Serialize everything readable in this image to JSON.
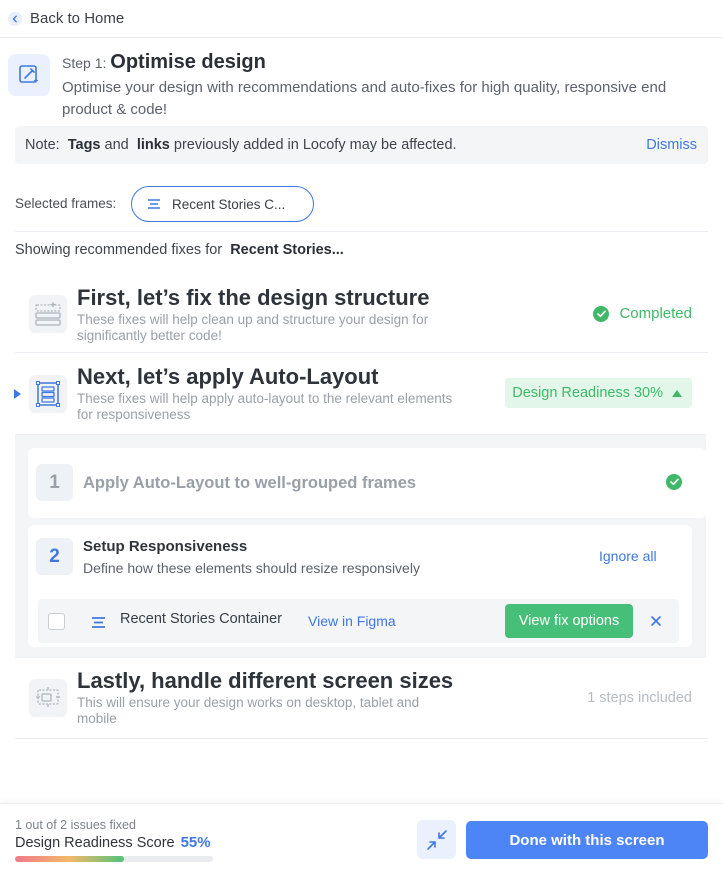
{
  "nav": {
    "back_label": "Back to Home"
  },
  "step": {
    "prefix": "Step 1: ",
    "title": "Optimise design",
    "description": "Optimise your design with recommendations and auto-fixes for high quality, responsive end product & code!"
  },
  "note": {
    "label": "Note:",
    "tags": "Tags",
    "and": "and",
    "links": "links",
    "rest": "previously added in Locofy may be affected.",
    "dismiss": "Dismiss"
  },
  "frames": {
    "label": "Selected frames:",
    "selected": "Recent Stories C..."
  },
  "showing": {
    "prefix": "Showing recommended fixes for",
    "target": "Recent Stories..."
  },
  "sections": [
    {
      "title": "First, let’s fix the design structure",
      "description": "These fixes will help clean up and structure your design for significantly better code!",
      "status": "Completed"
    },
    {
      "title": "Next, let’s apply Auto-Layout",
      "description": "These fixes will help apply auto-layout to the relevant elements for responsiveness",
      "readiness": "Design Readiness 30%"
    },
    {
      "title": "Lastly, handle different screen sizes",
      "description": "This will ensure your design works on desktop, tablet and mobile",
      "steps": "1 steps included"
    }
  ],
  "fixes": [
    {
      "number": "1",
      "title": "Apply Auto-Layout to well-grouped frames",
      "done": true
    },
    {
      "number": "2",
      "title": "Setup Responsiveness",
      "subtitle": "Define how these elements should resize responsively",
      "ignore": "Ignore all",
      "item": {
        "name": "Recent Stories Container",
        "view_link": "View in Figma",
        "action": "View fix options"
      }
    }
  ],
  "footer": {
    "issues": "1 out of 2 issues fixed",
    "score_label": "Design Readiness Score",
    "score": "55%",
    "progress": 0.55,
    "done_label": "Done with this screen"
  },
  "colors": {
    "accent": "#3f78e0",
    "success": "#3fb868",
    "button_primary": "#4d84f6"
  }
}
